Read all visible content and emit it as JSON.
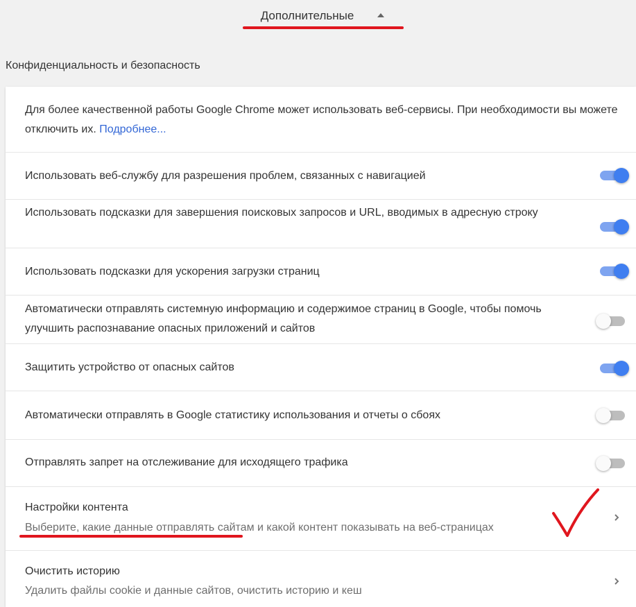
{
  "header": {
    "advanced_label": "Дополнительные"
  },
  "section": {
    "title": "Конфиденциальность и безопасность"
  },
  "intro": {
    "text": "Для более качественной работы Google Chrome может использовать веб-сервисы. При необходимости вы можете отключить их.",
    "link": "Подробнее..."
  },
  "settings": [
    {
      "label": "Использовать веб-службу для разрешения проблем, связанных с навигацией",
      "enabled": true
    },
    {
      "label": "Использовать подсказки для завершения поисковых запросов и URL, вводимых в адресную строку",
      "enabled": true
    },
    {
      "label": "Использовать подсказки для ускорения загрузки страниц",
      "enabled": true
    },
    {
      "label": "Автоматически отправлять системную информацию и содержимое страниц в Google, чтобы помочь улучшить распознавание опасных приложений и сайтов",
      "enabled": false
    },
    {
      "label": "Защитить устройство от опасных сайтов",
      "enabled": true
    },
    {
      "label": "Автоматически отправлять в Google статистику использования и отчеты о сбоях",
      "enabled": false
    },
    {
      "label": "Отправлять запрет на отслеживание для исходящего трафика",
      "enabled": false
    }
  ],
  "content_settings": {
    "title": "Настройки контента",
    "subtitle": "Выберите, какие данные отправлять сайтам и какой контент показывать на веб-страницах"
  },
  "clear_history": {
    "title": "Очистить историю",
    "subtitle": "Удалить файлы cookie и данные сайтов, очистить историю и кеш"
  },
  "colors": {
    "toggle_on": "#3f7ef0",
    "toggle_off": "#bdbdbd",
    "link": "#3367d6",
    "annotation_red": "#e0161e"
  }
}
